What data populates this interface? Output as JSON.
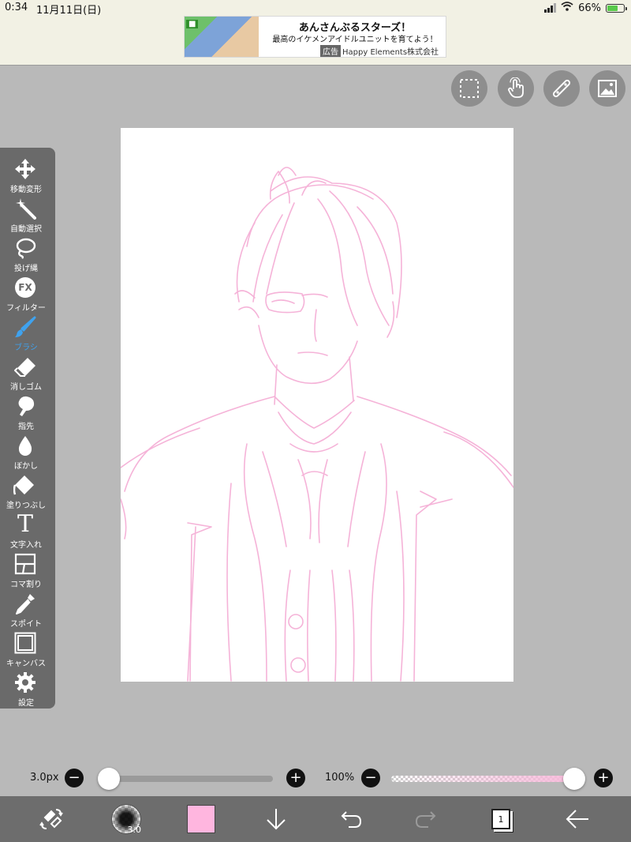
{
  "status": {
    "time": "0:34",
    "date": "11月11日(日)",
    "battery": "66%",
    "battery_level": 0.66
  },
  "ad": {
    "title": "あんさんぶるスターズ！",
    "description": "最高のイケメンアイドルユニットを育てよう！",
    "badge": "広告",
    "company": "Happy Elements株式会社"
  },
  "top_tools": [
    {
      "name": "selection-icon"
    },
    {
      "name": "touch-icon"
    },
    {
      "name": "ruler-icon"
    },
    {
      "name": "image-icon"
    }
  ],
  "toolbar": {
    "items": [
      {
        "label": "移動変形",
        "icon": "move-icon"
      },
      {
        "label": "自動選択",
        "icon": "magic-wand-icon"
      },
      {
        "label": "投げ縄",
        "icon": "lasso-icon"
      },
      {
        "label": "フィルター",
        "icon": "fx-icon",
        "icon_text": "FX"
      },
      {
        "label": "ブラシ",
        "icon": "brush-icon"
      },
      {
        "label": "消しゴム",
        "icon": "eraser-icon"
      },
      {
        "label": "指先",
        "icon": "finger-icon"
      },
      {
        "label": "ぼかし",
        "icon": "blur-icon"
      },
      {
        "label": "塗りつぶし",
        "icon": "fill-icon"
      },
      {
        "label": "文字入れ",
        "icon": "text-icon",
        "icon_text": "T"
      },
      {
        "label": "コマ割り",
        "icon": "frame-icon"
      },
      {
        "label": "スポイト",
        "icon": "eyedropper-icon"
      },
      {
        "label": "キャンバス",
        "icon": "canvas-icon"
      },
      {
        "label": "設定",
        "icon": "gear-icon"
      }
    ],
    "active_label": "ブラシ",
    "active_color": "#3fa2ee"
  },
  "brush": {
    "size_label": "3.0px",
    "size_fraction": 0.0,
    "opacity_label": "100%",
    "opacity_fraction": 1.0,
    "preview_label": "3.0",
    "minus": "−",
    "plus": "+"
  },
  "colors": {
    "brush_color": "#ffb6df",
    "stroke_color": "#f5b3d8",
    "toolbar_bg": "#6a6a6a",
    "app_bg": "#b9b9b9"
  },
  "layers": {
    "count": "1"
  }
}
